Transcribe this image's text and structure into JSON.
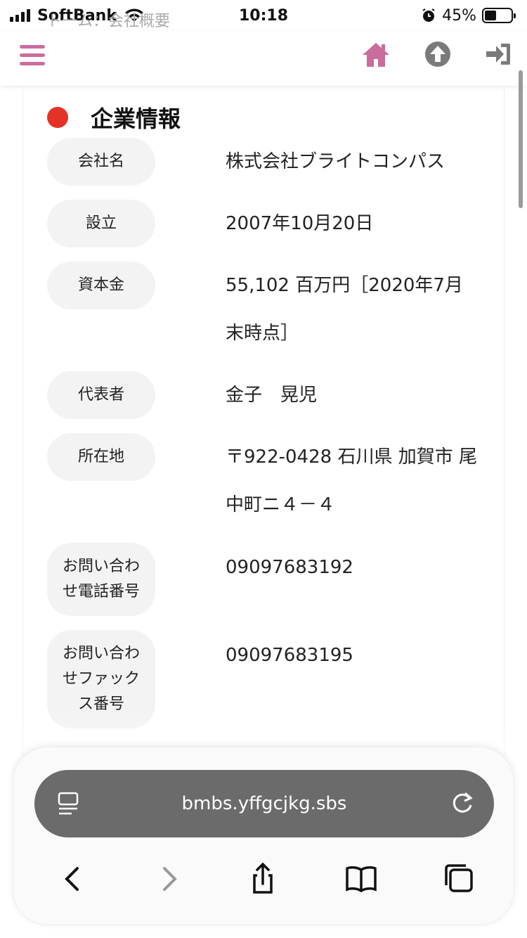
{
  "status": {
    "carrier": "SoftBank",
    "time": "10:18",
    "battery": "45%",
    "page_title_faded": "ト一ム：会社概要"
  },
  "company": {
    "section_title": "企業情報",
    "rows": [
      {
        "label": "会社名",
        "value": "株式会社ブライトコンパス"
      },
      {
        "label": "設立",
        "value": "2007年10月20日"
      },
      {
        "label": "資本金",
        "value": "55,102 百万円［2020年7月末時点］"
      },
      {
        "label": "代表者",
        "value": "金子　晃児"
      },
      {
        "label": "所在地",
        "value": "〒922-0428 石川県 加賀市 尾中町ニ４－４"
      },
      {
        "label": "お問い合わせ電話番号",
        "value": "09097683192"
      },
      {
        "label": "お問い合わせファックス番号",
        "value": "09097683195"
      }
    ]
  },
  "browser": {
    "url": "bmbs.yffgcjkg.sbs"
  },
  "icons": {
    "menu": "menu-icon",
    "home": "home-icon",
    "up": "arrow-up-icon",
    "login": "login-icon",
    "accent": "#c96d9e",
    "dot": "#e53226"
  }
}
